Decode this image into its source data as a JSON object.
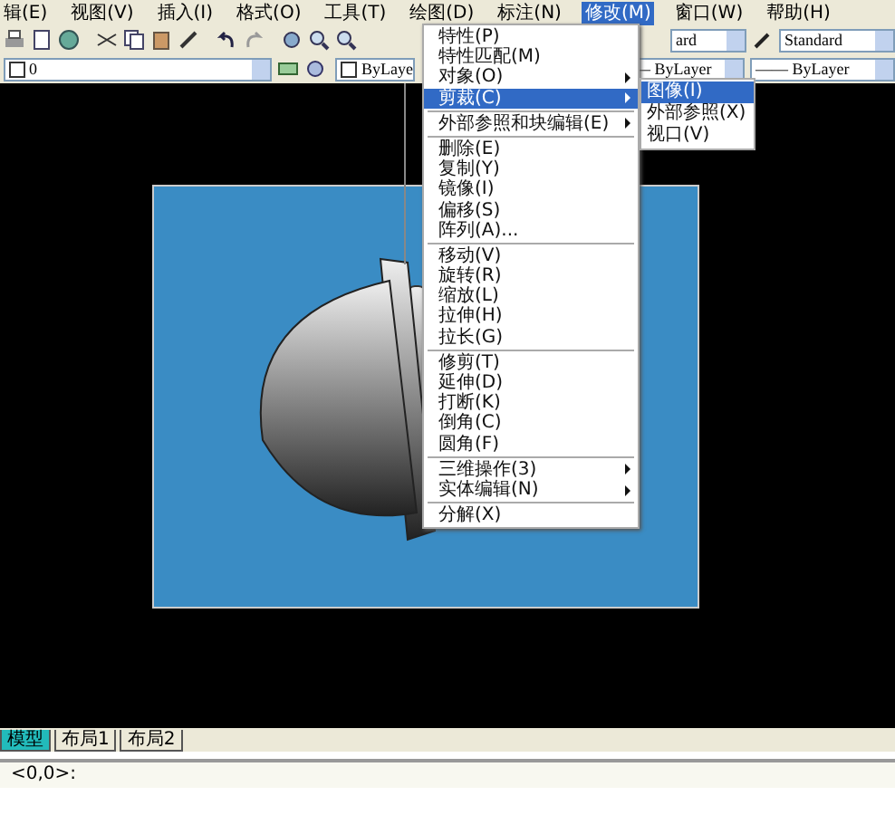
{
  "menubar": [
    {
      "label": "辑(E)",
      "selected": false
    },
    {
      "label": "视图(V)",
      "selected": false
    },
    {
      "label": "插入(I)",
      "selected": false
    },
    {
      "label": "格式(O)",
      "selected": false
    },
    {
      "label": "工具(T)",
      "selected": false
    },
    {
      "label": "绘图(D)",
      "selected": false
    },
    {
      "label": "标注(N)",
      "selected": false
    },
    {
      "label": "修改(M)",
      "selected": true
    },
    {
      "label": "窗口(W)",
      "selected": false
    },
    {
      "label": "帮助(H)",
      "selected": false
    }
  ],
  "toolbar": {
    "text_style": "ard",
    "dim_style": "Standard",
    "layer": "0",
    "color_dropdown": "ByLaye",
    "linetype": "— ByLayer",
    "lineweight": "—— ByLayer"
  },
  "menu": [
    {
      "kind": "item",
      "label": "特性(P)",
      "submenu": false,
      "selected": false
    },
    {
      "kind": "item",
      "label": "特性匹配(M)",
      "submenu": false,
      "selected": false
    },
    {
      "kind": "item",
      "label": "对象(O)",
      "submenu": true,
      "selected": false
    },
    {
      "kind": "item",
      "label": "剪裁(C)",
      "submenu": true,
      "selected": true
    },
    {
      "kind": "separator"
    },
    {
      "kind": "item",
      "label": "外部参照和块编辑(E)",
      "submenu": true,
      "selected": false
    },
    {
      "kind": "separator"
    },
    {
      "kind": "item",
      "label": "删除(E)",
      "submenu": false,
      "selected": false
    },
    {
      "kind": "item",
      "label": "复制(Y)",
      "submenu": false,
      "selected": false
    },
    {
      "kind": "item",
      "label": "镜像(I)",
      "submenu": false,
      "selected": false
    },
    {
      "kind": "item",
      "label": "偏移(S)",
      "submenu": false,
      "selected": false
    },
    {
      "kind": "item",
      "label": "阵列(A)...",
      "submenu": false,
      "selected": false
    },
    {
      "kind": "separator"
    },
    {
      "kind": "item",
      "label": "移动(V)",
      "submenu": false,
      "selected": false
    },
    {
      "kind": "item",
      "label": "旋转(R)",
      "submenu": false,
      "selected": false
    },
    {
      "kind": "item",
      "label": "缩放(L)",
      "submenu": false,
      "selected": false
    },
    {
      "kind": "item",
      "label": "拉伸(H)",
      "submenu": false,
      "selected": false
    },
    {
      "kind": "item",
      "label": "拉长(G)",
      "submenu": false,
      "selected": false
    },
    {
      "kind": "separator"
    },
    {
      "kind": "item",
      "label": "修剪(T)",
      "submenu": false,
      "selected": false
    },
    {
      "kind": "item",
      "label": "延伸(D)",
      "submenu": false,
      "selected": false
    },
    {
      "kind": "item",
      "label": "打断(K)",
      "submenu": false,
      "selected": false
    },
    {
      "kind": "item",
      "label": "倒角(C)",
      "submenu": false,
      "selected": false
    },
    {
      "kind": "item",
      "label": "圆角(F)",
      "submenu": false,
      "selected": false
    },
    {
      "kind": "separator"
    },
    {
      "kind": "item",
      "label": "三维操作(3)",
      "submenu": true,
      "selected": false
    },
    {
      "kind": "item",
      "label": "实体编辑(N)",
      "submenu": true,
      "selected": false
    },
    {
      "kind": "separator"
    },
    {
      "kind": "item",
      "label": "分解(X)",
      "submenu": false,
      "selected": false
    }
  ],
  "submenu": [
    {
      "label": "图像(I)",
      "selected": true
    },
    {
      "label": "外部参照(X)",
      "selected": false
    },
    {
      "label": "视口(V)",
      "selected": false
    }
  ],
  "layout_tabs": [
    {
      "label": "模型",
      "selected": true
    },
    {
      "label": "布局1",
      "selected": false
    },
    {
      "label": "布局2",
      "selected": false
    }
  ],
  "command_line": "<0,0>:"
}
